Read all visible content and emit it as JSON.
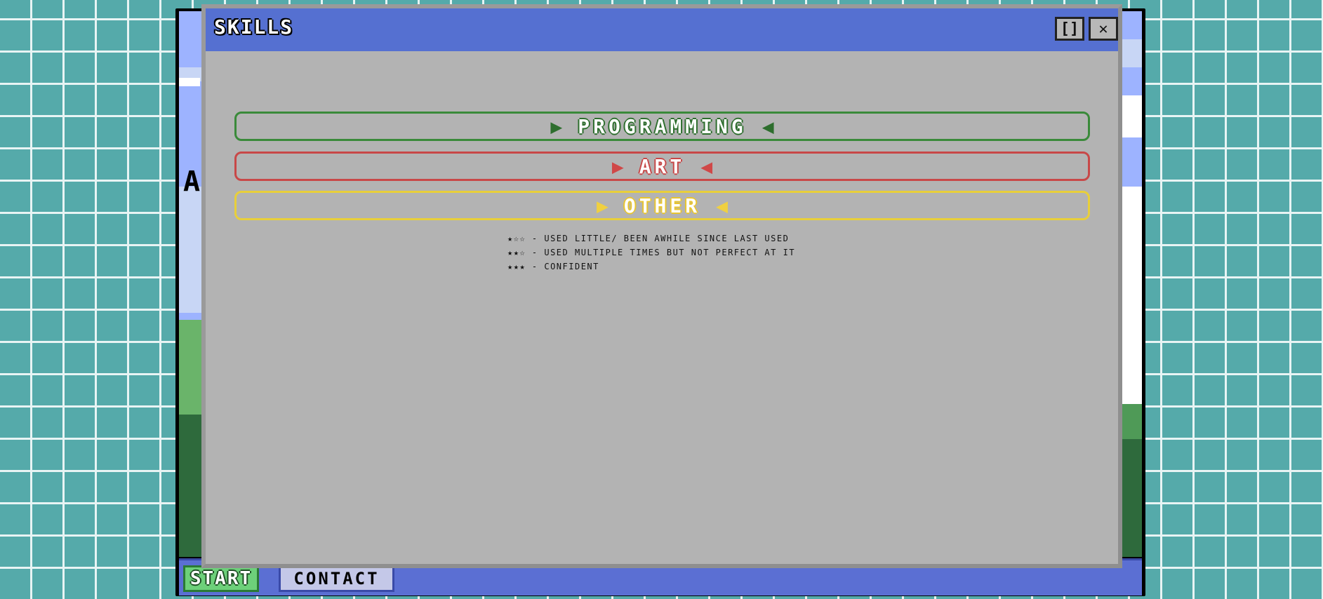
{
  "window": {
    "title": "SKILLS",
    "maximize_label": "[]",
    "close_label": "✕"
  },
  "skills": [
    {
      "label": "PROGRAMMING",
      "color": "#2d6e2d"
    },
    {
      "label": "ART",
      "color": "#c84848"
    },
    {
      "label": "OTHER",
      "color": "#e8c530"
    }
  ],
  "legend": [
    "★☆☆ - USED LITTLE/ BEEN AWHILE SINCE LAST USED",
    "★★☆ - USED MULTIPLE TIMES BUT NOT PERFECT AT IT",
    "★★★ - CONFIDENT"
  ],
  "taskbar": {
    "start_label": "START",
    "tabs": [
      "CONTACT"
    ]
  },
  "background": {
    "partial_letter": "A"
  },
  "colors": {
    "desktop": "#55aaaa",
    "titlebar": "#5570d1",
    "window_body": "#b3b3b3",
    "taskbar": "#5b6fd3"
  }
}
